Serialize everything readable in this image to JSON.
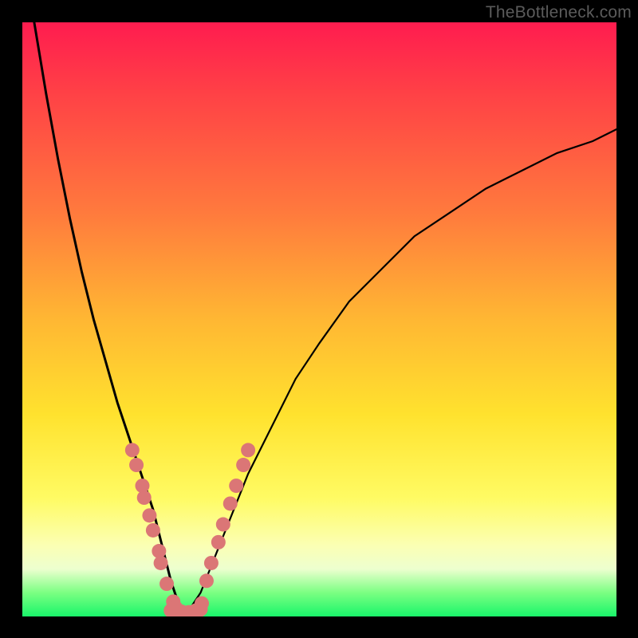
{
  "watermark": "TheBottleneck.com",
  "chart_data": {
    "type": "line",
    "title": "",
    "xlabel": "",
    "ylabel": "",
    "xlim": [
      0,
      100
    ],
    "ylim": [
      0,
      100
    ],
    "series": [
      {
        "name": "left-curve",
        "x": [
          2,
          4,
          6,
          8,
          10,
          12,
          14,
          16,
          18,
          20,
          21,
          22,
          23,
          24,
          25,
          26,
          27
        ],
        "values": [
          100,
          88,
          77,
          67,
          58,
          50,
          43,
          36,
          30,
          24,
          21,
          18,
          14,
          10,
          6,
          3,
          1
        ]
      },
      {
        "name": "right-curve",
        "x": [
          28,
          30,
          32,
          34,
          36,
          38,
          42,
          46,
          50,
          55,
          60,
          66,
          72,
          78,
          84,
          90,
          96,
          100
        ],
        "values": [
          1,
          4,
          9,
          14,
          19,
          24,
          32,
          40,
          46,
          53,
          58,
          64,
          68,
          72,
          75,
          78,
          80,
          82
        ]
      },
      {
        "name": "valley-floor",
        "x": [
          25,
          26,
          27,
          28,
          29,
          30
        ],
        "values": [
          1,
          0.5,
          0.3,
          0.3,
          0.6,
          1.2
        ]
      }
    ],
    "dot_clusters": [
      {
        "name": "left-descending-dots",
        "color": "#db7676",
        "points": [
          {
            "x": 18.5,
            "y": 28
          },
          {
            "x": 19.2,
            "y": 25.5
          },
          {
            "x": 20.2,
            "y": 22
          },
          {
            "x": 20.5,
            "y": 20
          },
          {
            "x": 21.4,
            "y": 17
          },
          {
            "x": 22.0,
            "y": 14.5
          },
          {
            "x": 23.0,
            "y": 11
          },
          {
            "x": 23.3,
            "y": 9
          },
          {
            "x": 24.3,
            "y": 5.5
          },
          {
            "x": 25.4,
            "y": 2.5
          }
        ]
      },
      {
        "name": "right-ascending-dots",
        "color": "#db7676",
        "points": [
          {
            "x": 31.0,
            "y": 6
          },
          {
            "x": 31.8,
            "y": 9
          },
          {
            "x": 33.0,
            "y": 12.5
          },
          {
            "x": 33.8,
            "y": 15.5
          },
          {
            "x": 35.0,
            "y": 19
          },
          {
            "x": 36.0,
            "y": 22
          },
          {
            "x": 37.2,
            "y": 25.5
          },
          {
            "x": 38.0,
            "y": 28
          }
        ]
      },
      {
        "name": "valley-dots",
        "color": "#db7676",
        "points": [
          {
            "x": 25.8,
            "y": 1.5
          },
          {
            "x": 26.8,
            "y": 0.8
          },
          {
            "x": 28.0,
            "y": 0.7
          },
          {
            "x": 29.2,
            "y": 1.0
          },
          {
            "x": 30.2,
            "y": 2.2
          }
        ]
      }
    ],
    "gradient_stops": [
      {
        "pos": 0,
        "color": "#ff1c4f"
      },
      {
        "pos": 12,
        "color": "#ff4146"
      },
      {
        "pos": 32,
        "color": "#ff7a3d"
      },
      {
        "pos": 50,
        "color": "#ffb733"
      },
      {
        "pos": 66,
        "color": "#ffe22e"
      },
      {
        "pos": 80,
        "color": "#fffb63"
      },
      {
        "pos": 88,
        "color": "#fbffb3"
      },
      {
        "pos": 92,
        "color": "#edffcf"
      },
      {
        "pos": 96,
        "color": "#7bff82"
      },
      {
        "pos": 100,
        "color": "#19f56a"
      }
    ]
  }
}
